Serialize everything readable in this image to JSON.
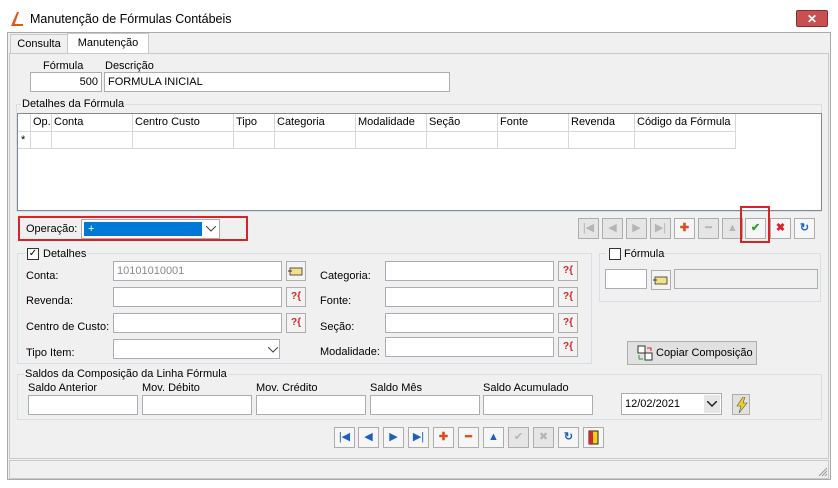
{
  "window": {
    "title": "Manutenção de Fórmulas Contábeis",
    "close_glyph": "✕"
  },
  "tabs": [
    {
      "label": "Consulta"
    },
    {
      "label": "Manutenção"
    }
  ],
  "header": {
    "formula_label": "Fórmula",
    "formula_value": "500",
    "descricao_label": "Descrição",
    "descricao_value": "FORMULA INICIAL"
  },
  "detalhes_formula": {
    "title": "Detalhes da Fórmula",
    "columns": [
      "Op.",
      "Conta",
      "Centro Custo",
      "Tipo",
      "Categoria",
      "Modalidade",
      "Seção",
      "Fonte",
      "Revenda",
      "Código da Fórmula"
    ],
    "new_row_marker": "*"
  },
  "operacao": {
    "label": "Operação:",
    "value": "+"
  },
  "nav_top": {
    "first": "|◀",
    "prev": "◀",
    "next": "▶",
    "last": "▶|",
    "add": "✚",
    "remove": "━",
    "up": "▲",
    "confirm": "✔",
    "cancel": "✖",
    "refresh": "↻"
  },
  "detalhes": {
    "checkbox_label": "Detalhes",
    "checked_glyph": "✓",
    "conta_label": "Conta:",
    "conta_value": "10101010001",
    "revenda_label": "Revenda:",
    "revenda_value": "",
    "centro_label": "Centro de Custo:",
    "centro_value": "",
    "tipo_item_label": "Tipo Item:",
    "tipo_item_value": "",
    "categoria_label": "Categoria:",
    "categoria_value": "",
    "fonte_label": "Fonte:",
    "fonte_value": "",
    "secao_label": "Seção:",
    "secao_value": "",
    "modalidade_label": "Modalidade:",
    "modalidade_value": "",
    "lookup_glyph": "?{"
  },
  "formula_box": {
    "checkbox_label": "Fórmula",
    "code_value": "",
    "desc_value": ""
  },
  "copiar": {
    "label": "Copiar Composição"
  },
  "saldos": {
    "title": "Saldos da Composição da Linha Fórmula",
    "saldo_anterior": "Saldo Anterior",
    "mov_debito": "Mov. Débito",
    "mov_credito": "Mov. Crédito",
    "saldo_mes": "Saldo Mês",
    "saldo_acumulado": "Saldo Acumulado",
    "date_value": "12/02/2021"
  },
  "colors": {
    "accent_red": "#d8232a",
    "nav_blue": "#1b5fc1",
    "confirm_green": "#2a9d2a"
  }
}
